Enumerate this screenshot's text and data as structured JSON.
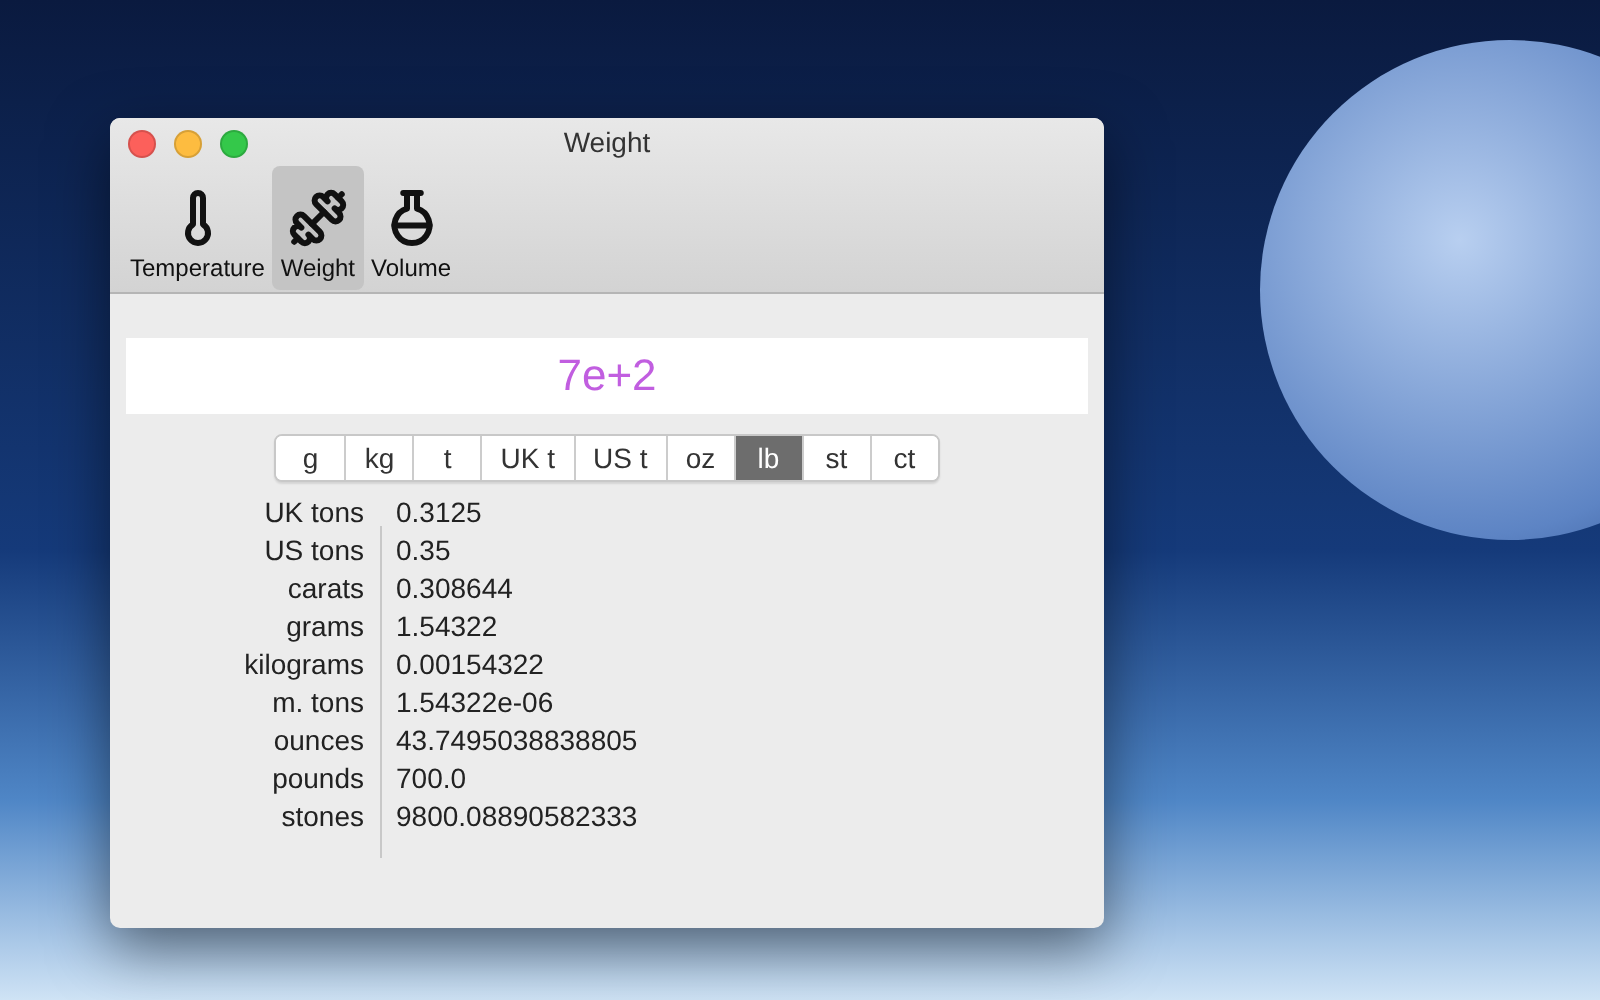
{
  "window": {
    "title": "Weight"
  },
  "toolbar": [
    {
      "kind": "temperature",
      "label": "Temperature",
      "selected": false
    },
    {
      "kind": "weight",
      "label": "Weight",
      "selected": true
    },
    {
      "kind": "volume",
      "label": "Volume",
      "selected": false
    }
  ],
  "input": {
    "value": "7e+2"
  },
  "units": [
    {
      "label": "g",
      "selected": false
    },
    {
      "label": "kg",
      "selected": false
    },
    {
      "label": "t",
      "selected": false
    },
    {
      "label": "UK t",
      "selected": false
    },
    {
      "label": "US t",
      "selected": false
    },
    {
      "label": "oz",
      "selected": false
    },
    {
      "label": "lb",
      "selected": true
    },
    {
      "label": "st",
      "selected": false
    },
    {
      "label": "ct",
      "selected": false
    }
  ],
  "results": [
    {
      "name": "UK tons",
      "value": "0.3125"
    },
    {
      "name": "US tons",
      "value": "0.35"
    },
    {
      "name": "carats",
      "value": "0.308644"
    },
    {
      "name": "grams",
      "value": "1.54322"
    },
    {
      "name": "kilograms",
      "value": "0.00154322"
    },
    {
      "name": "m. tons",
      "value": "1.54322e-06"
    },
    {
      "name": "ounces",
      "value": "43.7495038838805"
    },
    {
      "name": "pounds",
      "value": "700.0"
    },
    {
      "name": "stones",
      "value": "9800.08890582333"
    }
  ]
}
